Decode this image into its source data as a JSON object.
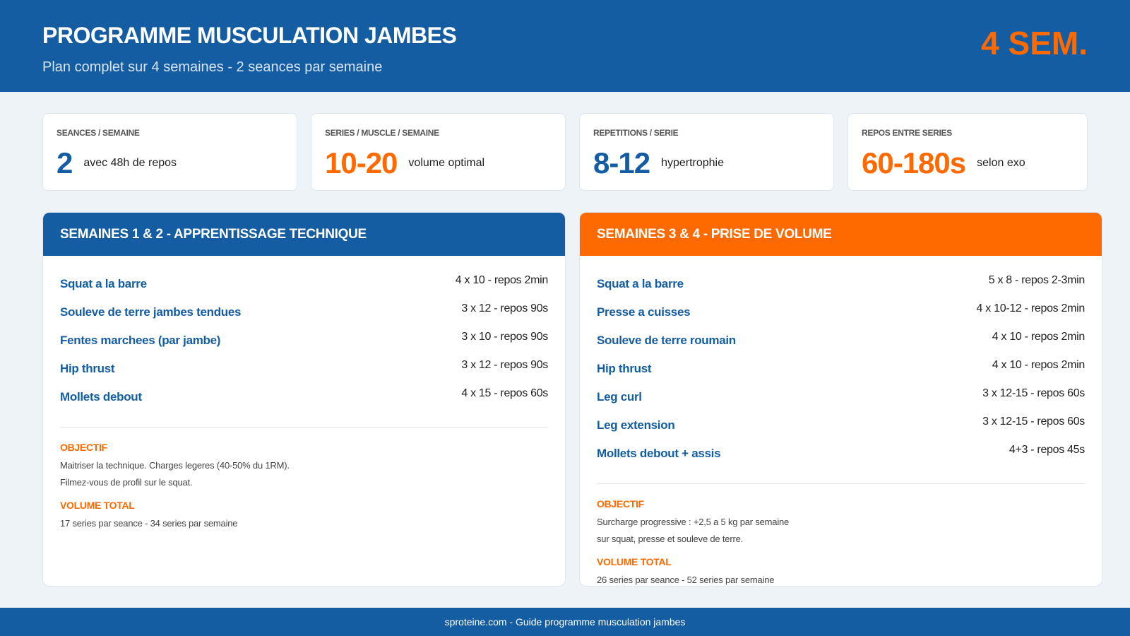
{
  "header": {
    "title": "PROGRAMME MUSCULATION JAMBES",
    "subtitle": "Plan complet sur 4 semaines - 2 seances par semaine",
    "badge": "4 SEM."
  },
  "stats": [
    {
      "label": "SEANCES / SEMAINE",
      "value": "2",
      "note": "avec 48h de repos",
      "color": "blue"
    },
    {
      "label": "SERIES / MUSCLE / SEMAINE",
      "value": "10-20",
      "note": "volume optimal",
      "color": "orange"
    },
    {
      "label": "REPETITIONS / SERIE",
      "value": "8-12",
      "note": "hypertrophie",
      "color": "blue"
    },
    {
      "label": "REPOS ENTRE SERIES",
      "value": "60-180s",
      "note": "selon exo",
      "color": "orange"
    }
  ],
  "panels": [
    {
      "title": "SEMAINES 1 & 2 - APPRENTISSAGE TECHNIQUE",
      "exercises": [
        {
          "name": "Squat a la barre",
          "sets": "4 x 10 - repos 2min"
        },
        {
          "name": "Souleve de terre jambes tendues",
          "sets": "3 x 12 - repos 90s"
        },
        {
          "name": "Fentes marchees (par jambe)",
          "sets": "3 x 10 - repos 90s"
        },
        {
          "name": "Hip thrust",
          "sets": "3 x 12 - repos 90s"
        },
        {
          "name": "Mollets debout",
          "sets": "4 x 15 - repos 60s"
        }
      ],
      "objective_label": "OBJECTIF",
      "objective_lines": [
        "Maitriser la technique. Charges legeres (40-50% du 1RM).",
        "Filmez-vous de profil sur le squat."
      ],
      "volume_label": "VOLUME TOTAL",
      "volume_text": "17 series par seance - 34 series par semaine"
    },
    {
      "title": "SEMAINES 3 & 4 - PRISE DE VOLUME",
      "exercises": [
        {
          "name": "Squat a la barre",
          "sets": "5 x 8 - repos 2-3min"
        },
        {
          "name": "Presse a cuisses",
          "sets": "4 x 10-12 - repos 2min"
        },
        {
          "name": "Souleve de terre roumain",
          "sets": "4 x 10 - repos 2min"
        },
        {
          "name": "Hip thrust",
          "sets": "4 x 10 - repos 2min"
        },
        {
          "name": "Leg curl",
          "sets": "3 x 12-15 - repos 60s"
        },
        {
          "name": "Leg extension",
          "sets": "3 x 12-15 - repos 60s"
        },
        {
          "name": "Mollets debout + assis",
          "sets": "4+3 - repos 45s"
        }
      ],
      "objective_label": "OBJECTIF",
      "objective_lines": [
        "Surcharge progressive : +2,5 a 5 kg par semaine",
        "sur squat, presse et souleve de terre."
      ],
      "volume_label": "VOLUME TOTAL",
      "volume_text": "26 series par seance - 52 series par semaine"
    }
  ],
  "footer": {
    "text": "sproteine.com - Guide programme musculation jambes"
  },
  "colors": {
    "primary": "#155da2",
    "accent": "#ff6a00",
    "background": "#eef3f8"
  }
}
